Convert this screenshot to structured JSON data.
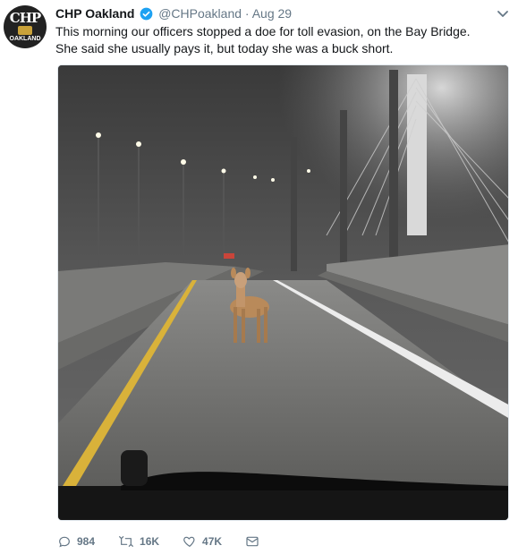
{
  "account": {
    "avatar_top": "CHP",
    "avatar_bottom": "OAKLAND",
    "display_name": "CHP Oakland",
    "handle": "@CHPoakland",
    "separator": "·",
    "date": "Aug 29"
  },
  "tweet": {
    "line1": "This morning our officers stopped a doe for toll evasion, on the Bay Bridge.",
    "line2": "She said she usually pays it, but today she was a buck short."
  },
  "actions": {
    "replies": "984",
    "retweets": "16K",
    "likes": "47K"
  },
  "colors": {
    "verified": "#1da1f2",
    "muted": "#657786",
    "text": "#14171a"
  }
}
